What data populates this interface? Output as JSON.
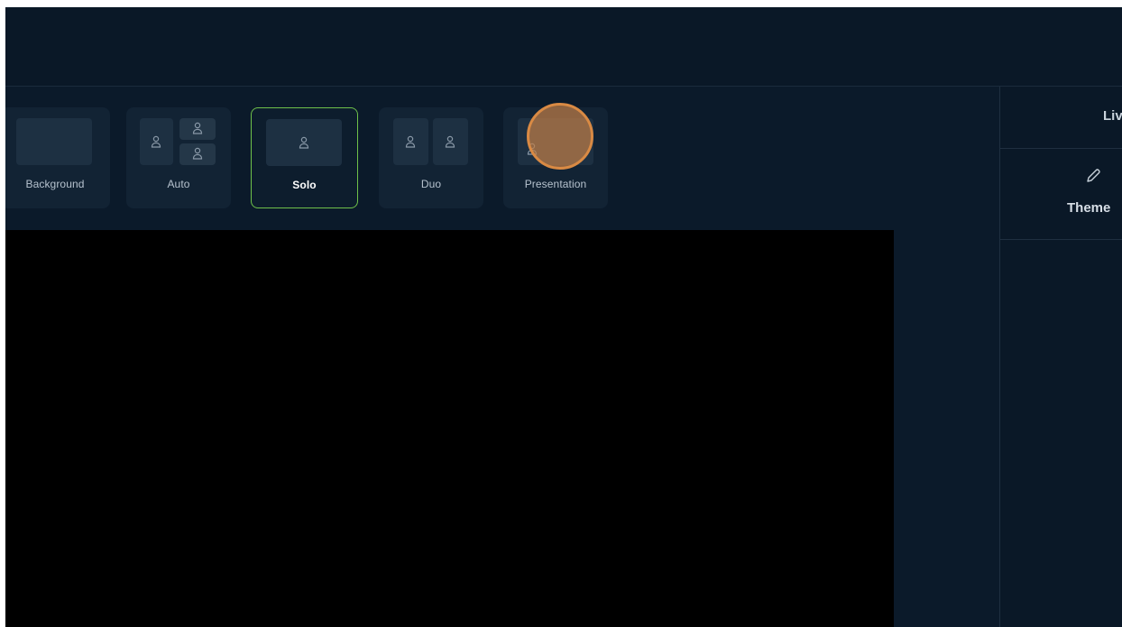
{
  "layouts": [
    {
      "label": "Background",
      "active": false
    },
    {
      "label": "Auto",
      "active": false
    },
    {
      "label": "Solo",
      "active": true
    },
    {
      "label": "Duo",
      "active": false
    },
    {
      "label": "Presentation",
      "active": false
    }
  ],
  "right_panel": {
    "tab_label": "Liv",
    "theme_label": "Theme"
  },
  "icons": {
    "person": "person-icon",
    "pencil": "pencil-icon"
  },
  "colors": {
    "active_border": "#6ec04a",
    "cursor_highlight": "#d98a44"
  }
}
